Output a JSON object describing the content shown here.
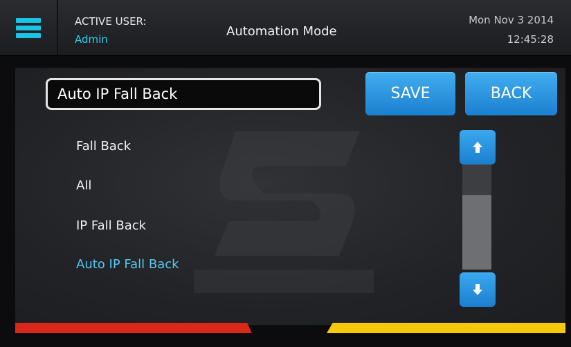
{
  "header": {
    "active_user_label": "ACTIVE USER:",
    "active_user_name": "Admin",
    "title": "Automation Mode",
    "date": "Mon Nov 3 2014",
    "time": "12:45:28"
  },
  "editor": {
    "name_value": "Auto IP Fall Back",
    "save_label": "SAVE",
    "back_label": "BACK"
  },
  "list": {
    "items": [
      "Fall Back",
      "All",
      "IP Fall Back",
      "Auto IP Fall Back"
    ],
    "selected": "Auto IP Fall Back"
  },
  "icons": {
    "menu": "hamburger-menu-icon",
    "scroll_up": "arrow-up-icon",
    "scroll_down": "arrow-down-icon",
    "watermark": "sur-gard-logo"
  },
  "status_colors": {
    "accent": "#19c4e6",
    "button": "#2a94e0",
    "selected_text": "#55c8f0",
    "left_status": "#d8281a",
    "right_status": "#f5c80a"
  }
}
